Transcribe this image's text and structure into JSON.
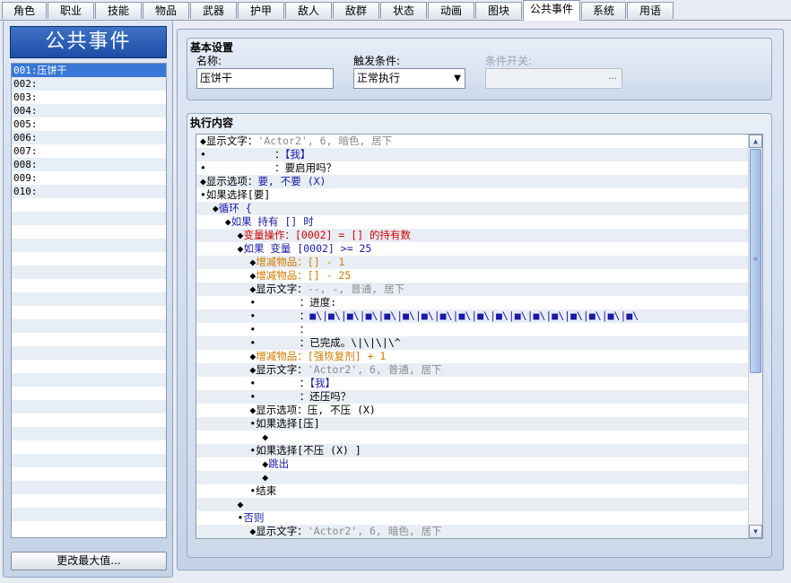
{
  "tabs": [
    "角色",
    "职业",
    "技能",
    "物品",
    "武器",
    "护甲",
    "敌人",
    "敌群",
    "状态",
    "动画",
    "图块",
    "公共事件",
    "系统",
    "用语"
  ],
  "active_tab": "公共事件",
  "left_panel": {
    "title": "公共事件",
    "events": [
      "001:压饼干",
      "002:",
      "003:",
      "004:",
      "005:",
      "006:",
      "007:",
      "008:",
      "009:",
      "010:"
    ],
    "selected_index": 0,
    "max_button": "更改最大值..."
  },
  "basic": {
    "title": "基本设置",
    "name_label": "名称:",
    "name_value": "压饼干",
    "trigger_label": "触发条件:",
    "trigger_value": "正常执行",
    "switch_label": "条件开关:",
    "switch_button": "..."
  },
  "exec": {
    "title": "执行内容",
    "lines": [
      {
        "segs": [
          [
            "◆显示文字：",
            "blk"
          ],
          [
            "'Actor2', 6, 暗色, 居下",
            "gray"
          ]
        ]
      },
      {
        "segs": [
          [
            "•           ：",
            "blk"
          ],
          [
            "【我】",
            "blue"
          ]
        ]
      },
      {
        "segs": [
          [
            "•           ：要启用吗？",
            "blk"
          ]
        ]
      },
      {
        "segs": [
          [
            "◆显示选项：",
            "blk"
          ],
          [
            "要, 不要 (X)",
            "blue"
          ]
        ]
      },
      {
        "segs": [
          [
            "•如果选择[要]",
            "blk"
          ]
        ]
      },
      {
        "segs": [
          [
            "  ◆",
            "blk"
          ],
          [
            "循环 {",
            "blue"
          ]
        ]
      },
      {
        "segs": [
          [
            "    ◆",
            "blk"
          ],
          [
            "如果 持有 [] 时",
            "blue"
          ]
        ]
      },
      {
        "segs": [
          [
            "      ◆",
            "blk"
          ],
          [
            "变量操作：[0002] = [] 的持有数",
            "red"
          ]
        ]
      },
      {
        "segs": [
          [
            "      ◆",
            "blk"
          ],
          [
            "如果 变量 [0002] >= 25",
            "blue"
          ]
        ]
      },
      {
        "segs": [
          [
            "        ◆",
            "blk"
          ],
          [
            "增减物品：[] - 1",
            "orange"
          ]
        ]
      },
      {
        "segs": [
          [
            "        ◆",
            "blk"
          ],
          [
            "增减物品：[] - 25",
            "orange"
          ]
        ]
      },
      {
        "segs": [
          [
            "        ◆显示文字：",
            "blk"
          ],
          [
            "--, -, 普通, 居下",
            "gray"
          ]
        ]
      },
      {
        "segs": [
          [
            "        •       ：进度:",
            "blk"
          ]
        ]
      },
      {
        "segs": [
          [
            "        •       ：",
            "blk"
          ],
          [
            "■\\|■\\|■\\|■\\|■\\|■\\|■\\|■\\|■\\|■\\|■\\|■\\|■\\|■\\|■\\|■\\|■\\|■\\",
            "bar"
          ]
        ]
      },
      {
        "segs": [
          [
            "        •       ：",
            "blk"
          ]
        ]
      },
      {
        "segs": [
          [
            "        •       ：已完成。\\|\\|\\|\\^",
            "blk"
          ]
        ]
      },
      {
        "segs": [
          [
            "        ◆",
            "blk"
          ],
          [
            "增减物品：[强恢复剂] + 1",
            "orange"
          ]
        ]
      },
      {
        "segs": [
          [
            "        ◆显示文字：",
            "blk"
          ],
          [
            "'Actor2', 6, 普通, 居下",
            "gray"
          ]
        ]
      },
      {
        "segs": [
          [
            "        •       ：",
            "blk"
          ],
          [
            "【我】",
            "blue"
          ]
        ]
      },
      {
        "segs": [
          [
            "        •       ：还压吗？",
            "blk"
          ]
        ]
      },
      {
        "segs": [
          [
            "        ◆显示选项：压, 不压 (X)",
            "blk"
          ]
        ]
      },
      {
        "segs": [
          [
            "        •如果选择[压]",
            "blk"
          ]
        ]
      },
      {
        "segs": [
          [
            "          ◆",
            "blk"
          ]
        ]
      },
      {
        "segs": [
          [
            "        •如果选择[不压 (X) ]",
            "blk"
          ]
        ]
      },
      {
        "segs": [
          [
            "          ◆",
            "blk"
          ],
          [
            "跳出",
            "blue"
          ]
        ]
      },
      {
        "segs": [
          [
            "          ◆",
            "blk"
          ]
        ]
      },
      {
        "segs": [
          [
            "        •结束",
            "blk"
          ]
        ]
      },
      {
        "segs": [
          [
            "      ◆",
            "blk"
          ]
        ]
      },
      {
        "segs": [
          [
            "      •",
            "blk"
          ],
          [
            "否则",
            "blue"
          ]
        ]
      },
      {
        "segs": [
          [
            "        ◆显示文字：",
            "blk"
          ],
          [
            "'Actor2', 6, 暗色, 居下",
            "gray"
          ]
        ]
      }
    ]
  },
  "colors": {
    "blk": "#000000",
    "gray": "#8a8a8a",
    "blue": "#1a1aa6",
    "red": "#d00000",
    "orange": "#d07a00",
    "bar": "#1a1aa6"
  }
}
